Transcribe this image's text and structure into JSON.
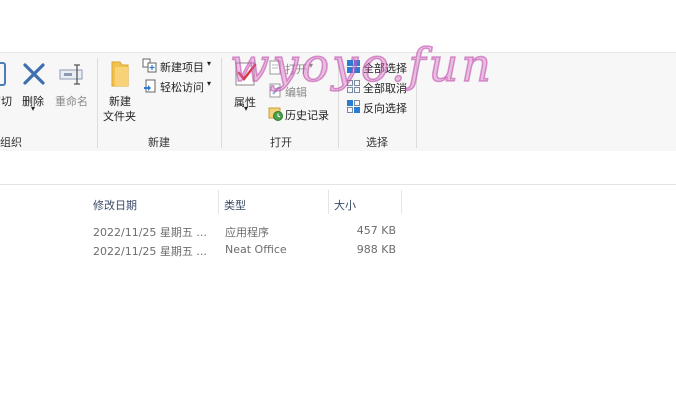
{
  "ribbon": {
    "organize": {
      "cut_fragment": "剪切",
      "delete_label": "删除",
      "rename_label": "重命名",
      "group_label": "组织"
    },
    "new": {
      "new_folder_line1": "新建",
      "new_folder_line2": "文件夹",
      "new_item_label": "新建项目",
      "easy_access_label": "轻松访问",
      "group_label": "新建"
    },
    "open": {
      "properties_label": "属性",
      "open_label": "打开",
      "edit_label": "编辑",
      "history_label": "历史记录",
      "group_label": "打开"
    },
    "select": {
      "select_all_label": "全部选择",
      "select_none_label": "全部取消",
      "invert_label": "反向选择",
      "group_label": "选择"
    }
  },
  "columns": {
    "date": "修改日期",
    "type": "类型",
    "size": "大小"
  },
  "files": [
    {
      "date": "2022/11/25 星期五 ...",
      "type": "应用程序",
      "size": "457 KB"
    },
    {
      "date": "2022/11/25 星期五 ...",
      "type": "Neat Office",
      "size": "988 KB"
    }
  ],
  "watermark": "wyoyo.fun",
  "colors": {
    "ribbon_bg": "#f7f7f7",
    "accent_blue": "#2b7cd3",
    "folder_yellow": "#f2c14e",
    "watermark_pink": "#d66ec2"
  }
}
